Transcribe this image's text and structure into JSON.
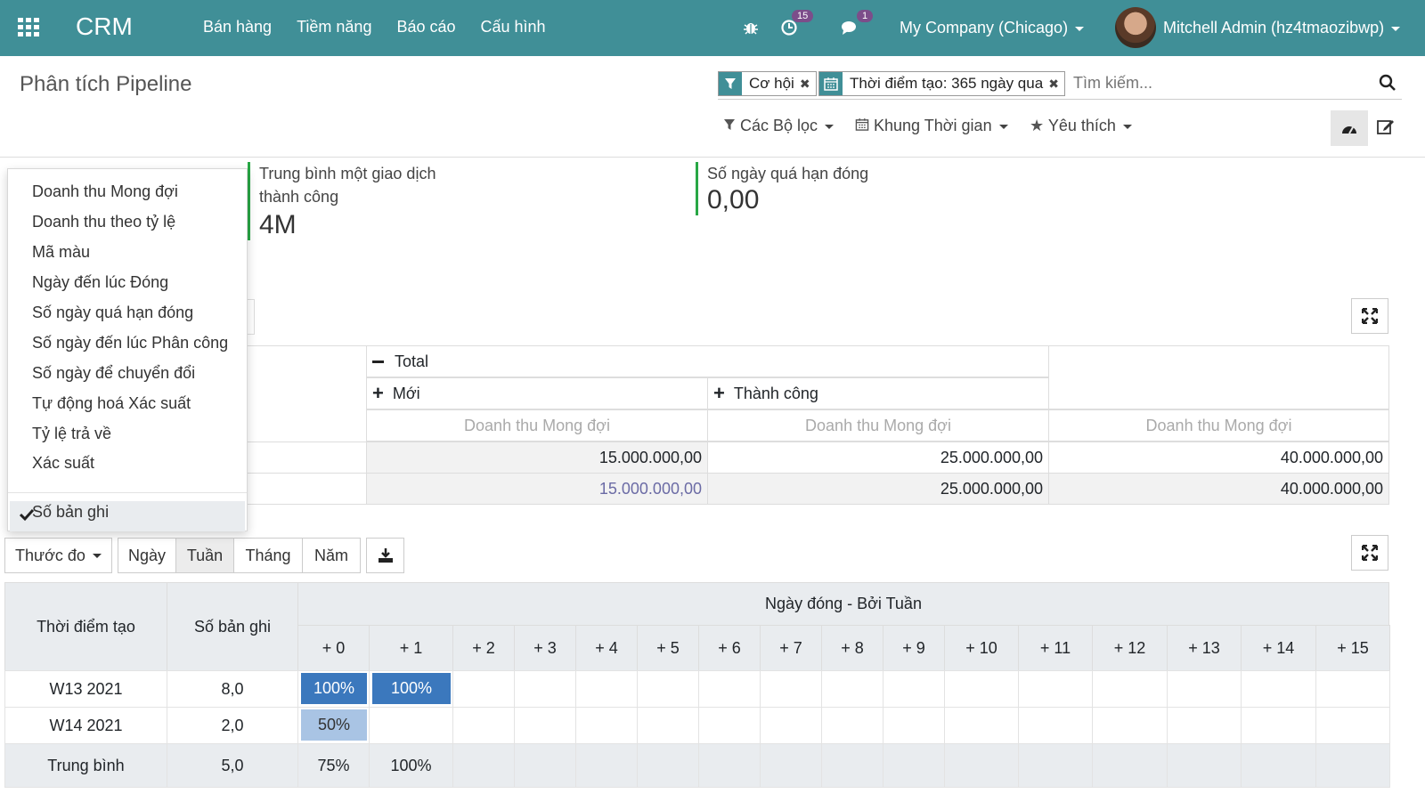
{
  "navbar": {
    "brand": "CRM",
    "menu": [
      "Bán hàng",
      "Tiềm năng",
      "Báo cáo",
      "Cấu hình"
    ],
    "activity_badge": "15",
    "message_badge": "1",
    "company": "My Company (Chicago)",
    "user": "Mitchell Admin (hz4tmaozibwp)"
  },
  "control": {
    "title": "Phân tích Pipeline",
    "facets": [
      "Cơ hội",
      "Thời điểm tạo: 365 ngày qua"
    ],
    "search_placeholder": "Tìm kiếm...",
    "filters_label": "Các Bộ lọc",
    "timeframe_label": "Khung Thời gian",
    "favorites_label": "Yêu thích"
  },
  "kpis": [
    {
      "label_line1": "Trung bình một giao dịch",
      "label_line2": "thành công",
      "value": "4M"
    },
    {
      "label_line1": "Số ngày quá hạn đóng",
      "label_line2": "",
      "value": "0,00"
    }
  ],
  "pivot": {
    "total_header": "Total",
    "col_new": "Mới",
    "col_won": "Thành công",
    "measure": "Doanh thu Mong đợi",
    "rows": [
      [
        "15.000.000,00",
        "25.000.000,00",
        "40.000.000,00"
      ],
      [
        "15.000.000,00",
        "25.000.000,00",
        "40.000.000,00"
      ]
    ]
  },
  "measures_menu": {
    "items": [
      "Doanh thu Mong đợi",
      "Doanh thu theo tỷ lệ",
      "Mã màu",
      "Ngày đến lúc Đóng",
      "Số ngày quá hạn đóng",
      "Số ngày đến lúc Phân công",
      "Số ngày để chuyển đổi",
      "Tự động hoá Xác suất",
      "Tỷ lệ trả về",
      "Xác suất"
    ],
    "selected": "Số bản ghi"
  },
  "cohort": {
    "measure_button": "Thước đo",
    "intervals": [
      "Ngày",
      "Tuần",
      "Tháng",
      "Năm"
    ],
    "active_interval": "Tuần",
    "col_created": "Thời điểm tạo",
    "col_count": "Số bản ghi",
    "col_group": "Ngày đóng - Bởi Tuần",
    "offsets": [
      "+ 0",
      "+ 1",
      "+ 2",
      "+ 3",
      "+ 4",
      "+ 5",
      "+ 6",
      "+ 7",
      "+ 8",
      "+ 9",
      "+ 10",
      "+ 11",
      "+ 12",
      "+ 13",
      "+ 14",
      "+ 15"
    ],
    "rows": [
      {
        "label": "W13 2021",
        "count": "8,0",
        "cells": [
          "100%",
          "100%"
        ]
      },
      {
        "label": "W14 2021",
        "count": "2,0",
        "cells": [
          "50%"
        ]
      }
    ],
    "average": {
      "label": "Trung bình",
      "count": "5,0",
      "cells": [
        "75%",
        "100%"
      ]
    },
    "colors": {
      "full": "#3b78bd",
      "half": "#a9c4e4"
    }
  }
}
